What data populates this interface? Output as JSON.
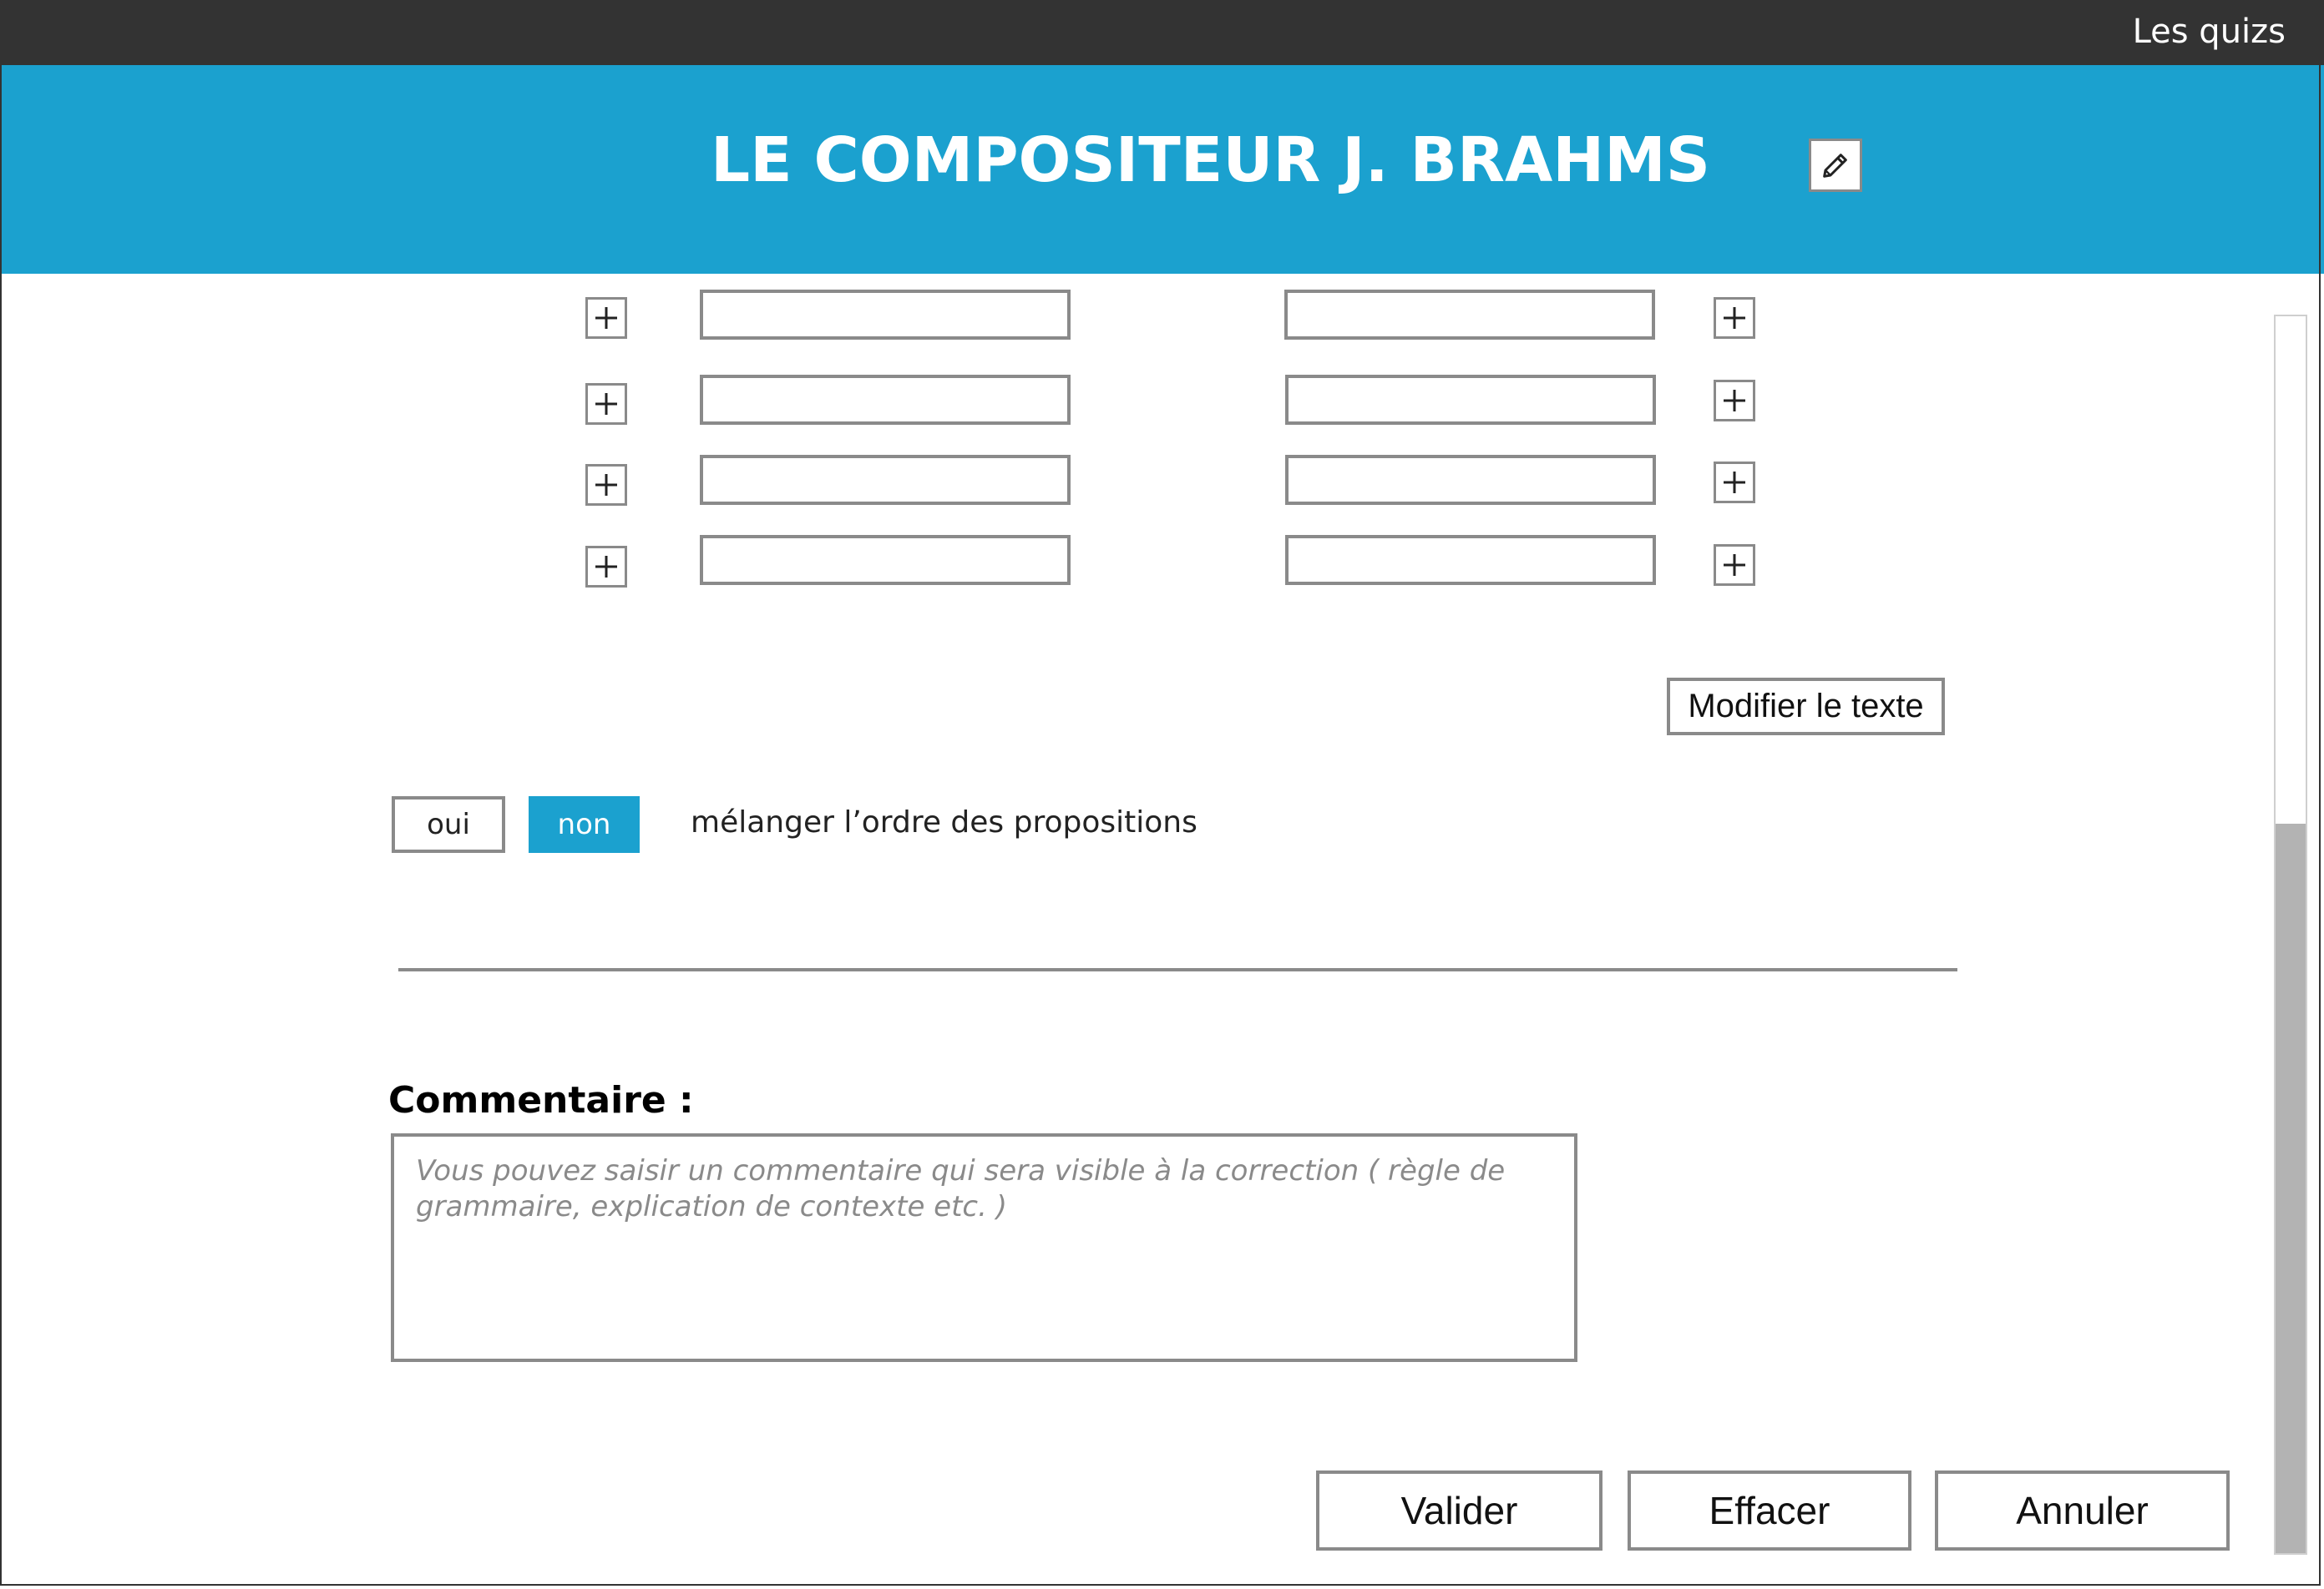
{
  "topbar": {
    "link_label": "Les quizs"
  },
  "header": {
    "title": "LE COMPOSITEUR J. BRAHMS",
    "edit_icon": "pencil-icon"
  },
  "pairs": {
    "rows": [
      {
        "left_value": "",
        "right_value": ""
      },
      {
        "left_value": "",
        "right_value": ""
      },
      {
        "left_value": "",
        "right_value": ""
      },
      {
        "left_value": "",
        "right_value": ""
      }
    ],
    "add_icon": "plus-icon"
  },
  "modify_text_label": "Modifier le texte",
  "shuffle": {
    "yes_label": "oui",
    "no_label": "non",
    "selected": "non",
    "label": "mélanger l’ordre des propositions"
  },
  "comment": {
    "label": "Commentaire :",
    "placeholder": "Vous pouvez saisir un commentaire qui sera visible à la correction ( règle de grammaire, explication de contexte etc. )",
    "value": ""
  },
  "actions": {
    "validate_label": "Valider",
    "clear_label": "Effacer",
    "cancel_label": "Annuler"
  },
  "colors": {
    "accent": "#1ba1cf",
    "topbar": "#333333",
    "border": "#8a8a8a",
    "scroll_thumb": "#b3b3b3"
  },
  "scroll": {
    "thumb_fraction": 0.59
  }
}
